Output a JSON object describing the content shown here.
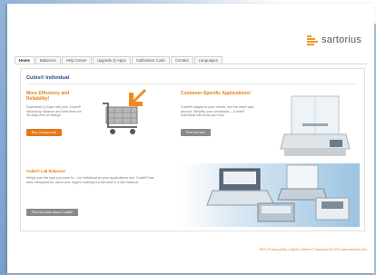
{
  "brand": {
    "name": "sartorius",
    "accent": "#f39a1e"
  },
  "nav": {
    "tabs": [
      "Home",
      "Balances",
      "Help Center",
      "Upgrade Q-Apps",
      "Calibration Code",
      "Contact",
      "Languages"
    ],
    "active": "Home"
  },
  "main": {
    "title": "Cubis® Individual",
    "efficiency": {
      "heading": "More Efficiency and Reliability!",
      "text": "Download Q-Apps into your Cubis® laboratory balance and test them for 30 days free of charge.",
      "button": "Buy Q-Apps now"
    },
    "custom": {
      "heading": "Customer-Specific Applications!",
      "text": "Cubis® adapts to your needs, not the other way around. Simplify your workflows – Cubis® Individual will show you how.",
      "button": "Find out how"
    },
    "lab": {
      "heading": "Cubis® Lab Balances",
      "text": "Weigh just the way you want to – be individual as your applications are. Cubis® has been designed for users who regard nothing but the best in a lab balance.",
      "button": "Find out more about Cubis®"
    }
  },
  "footer": {
    "text": "RSS | Privacy policy | Imprint | Search © Sartorius AG 2011 www.sartorius.com"
  },
  "icons": [
    "logo-mark-icon",
    "shopping-cart-icon",
    "download-arrow-icon"
  ],
  "colors": {
    "heading": "#1e4e80",
    "orange": "#e4781a",
    "grey_button": "#8a8a8a"
  }
}
